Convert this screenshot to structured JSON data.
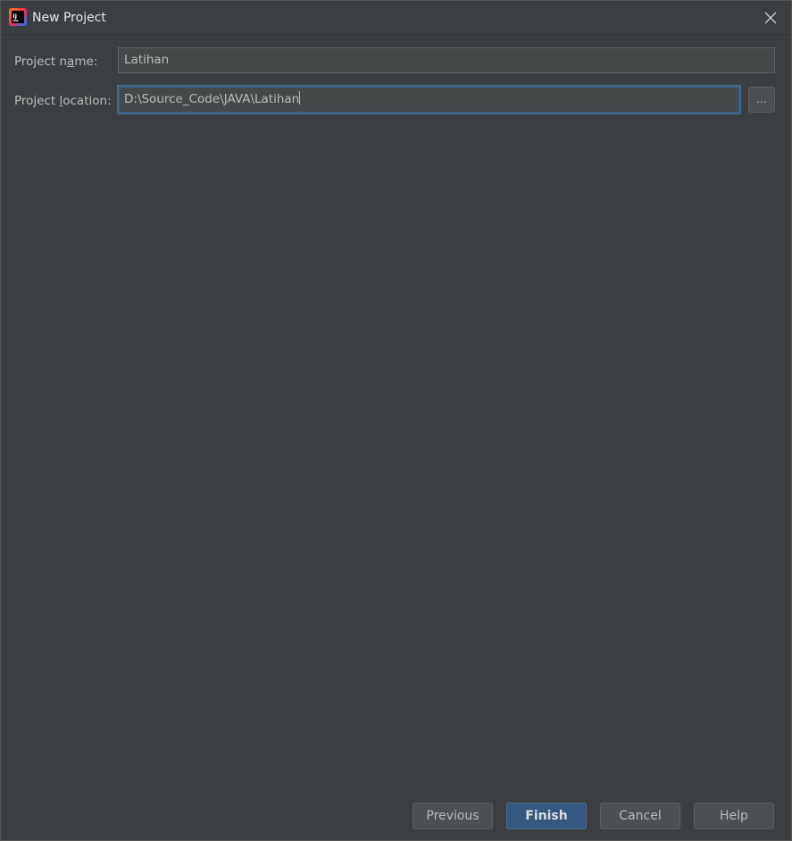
{
  "window": {
    "title": "New Project",
    "icon": "intellij-idea-icon",
    "close_icon": "close-icon"
  },
  "form": {
    "project_name": {
      "label_before": "Project n",
      "label_mnemonic": "a",
      "label_after": "me:",
      "value": "Latihan"
    },
    "project_location": {
      "label_before": "Project ",
      "label_mnemonic": "l",
      "label_after": "ocation:",
      "value": "D:\\Source_Code\\JAVA\\Latihan",
      "browse_label": "..."
    }
  },
  "buttons": {
    "previous": "Previous",
    "finish": "Finish",
    "cancel": "Cancel",
    "help": "Help"
  },
  "colors": {
    "background": "#3c3f41",
    "field_background": "#45494a",
    "focus_border": "#3d6185",
    "default_button": "#365880",
    "text": "#bbbbbb"
  }
}
